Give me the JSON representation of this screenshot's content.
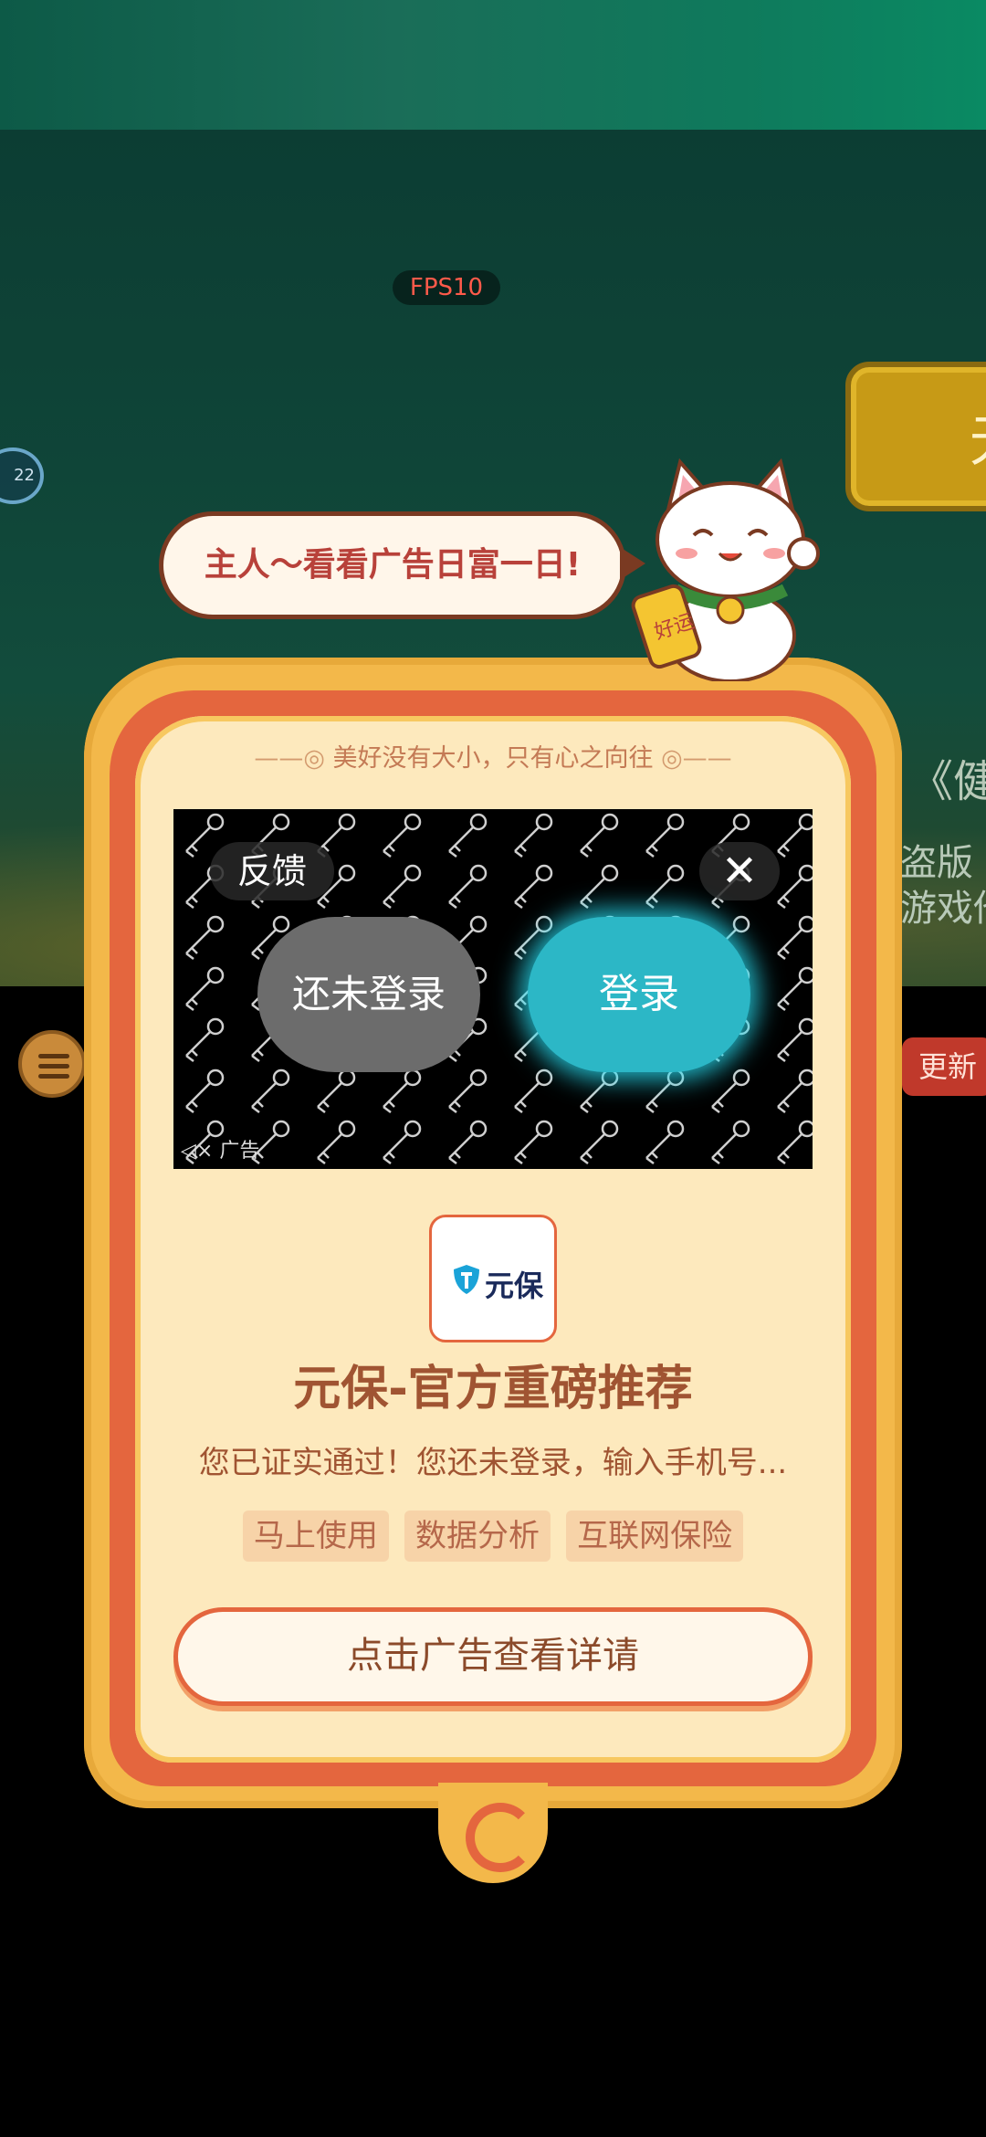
{
  "game": {
    "fps": "FPS10",
    "left_badge": "22",
    "right_gold_char": "无",
    "right_text_1": "《健",
    "right_text_2a": "盗版",
    "right_text_2b": "游戏他",
    "update_label": "更新"
  },
  "promo": {
    "bubble_text": "主人～看看广告日富一日!",
    "cat_badge": "好运",
    "motto": "美好没有大小，只有心之向往"
  },
  "ad": {
    "feedback_label": "反馈",
    "close_label": "✕",
    "not_logged_in_label": "还未登录",
    "login_label": "登录",
    "ad_tag": "广告",
    "app_logo_text": "元保",
    "app_title": "元保-官方重磅推荐",
    "description": "您已证实通过！您还未登录，输入手机号...",
    "tags": [
      "马上使用",
      "数据分析",
      "互联网保险"
    ],
    "cta_label": "点击广告查看详请"
  },
  "colors": {
    "frame_gold": "#f3b84a",
    "frame_red": "#e4663e",
    "card_bg": "#fde9bd",
    "login_teal": "#2cb7c6"
  }
}
